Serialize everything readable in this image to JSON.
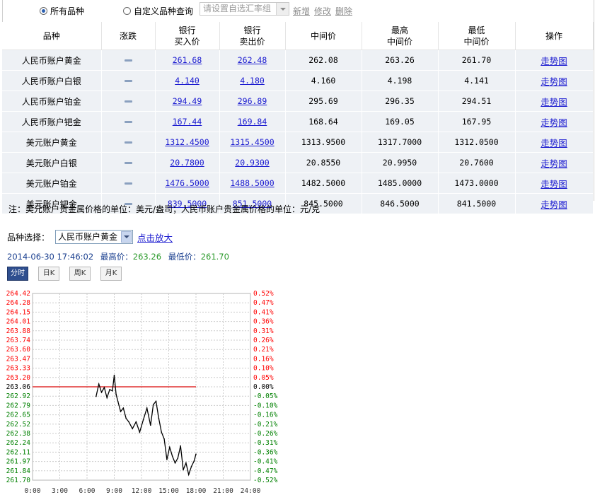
{
  "filter": {
    "radio_all": "所有品种",
    "radio_custom": "自定义品种查询",
    "combo_placeholder": "请设置自选汇率组",
    "add": "新增",
    "edit": "修改",
    "delete": "删除"
  },
  "table": {
    "headers": [
      "品种",
      "涨跌",
      "银行\n买入价",
      "银行\n卖出价",
      "中间价",
      "最高\n中间价",
      "最低\n中间价",
      "操作"
    ],
    "rows": [
      {
        "name": "人民币账户黄金",
        "buy": "261.68",
        "sell": "262.48",
        "mid": "262.08",
        "high": "263.26",
        "low": "261.70",
        "op": "走势图"
      },
      {
        "name": "人民币账户白银",
        "buy": "4.140",
        "sell": "4.180",
        "mid": "4.160",
        "high": "4.198",
        "low": "4.141",
        "op": "走势图"
      },
      {
        "name": "人民币账户铂金",
        "buy": "294.49",
        "sell": "296.89",
        "mid": "295.69",
        "high": "296.35",
        "low": "294.51",
        "op": "走势图"
      },
      {
        "name": "人民币账户钯金",
        "buy": "167.44",
        "sell": "169.84",
        "mid": "168.64",
        "high": "169.05",
        "low": "167.95",
        "op": "走势图"
      },
      {
        "name": "美元账户黄金",
        "buy": "1312.4500",
        "sell": "1315.4500",
        "mid": "1313.9500",
        "high": "1317.7000",
        "low": "1312.0500",
        "op": "走势图"
      },
      {
        "name": "美元账户白银",
        "buy": "20.7800",
        "sell": "20.9300",
        "mid": "20.8550",
        "high": "20.9950",
        "low": "20.7600",
        "op": "走势图"
      },
      {
        "name": "美元账户铂金",
        "buy": "1476.5000",
        "sell": "1488.5000",
        "mid": "1482.5000",
        "high": "1485.0000",
        "low": "1473.0000",
        "op": "走势图"
      },
      {
        "name": "美元账户钯金",
        "buy": "839.5000",
        "sell": "851.5000",
        "mid": "845.5000",
        "high": "846.5000",
        "low": "841.5000",
        "op": "走势图"
      }
    ]
  },
  "note": "注：美元账户贵金属价格的单位：美元/盎司；人民币账户贵金属价格的单位：元/克",
  "selector": {
    "label": "品种选择：",
    "value": "人民币账户黄金",
    "zoom": "点击放大"
  },
  "info": {
    "datetime": "2014-06-30 17:46:02",
    "high_label": "最高价：",
    "high_value": "263.26",
    "low_label": "最低价：",
    "low_value": "261.70"
  },
  "tabs": [
    "分时",
    "日K",
    "周K",
    "月K"
  ],
  "colors": {
    "up": "#ff0000",
    "down": "#008000",
    "ref_line": "#e03030",
    "line": "#000000",
    "grid": "#cccccc"
  },
  "chart_data": {
    "type": "line",
    "y_left_ticks": [
      "264.42",
      "264.28",
      "264.15",
      "264.01",
      "263.88",
      "263.74",
      "263.60",
      "263.47",
      "263.33",
      "263.20",
      "263.06",
      "262.92",
      "262.79",
      "262.65",
      "262.52",
      "262.38",
      "262.24",
      "262.11",
      "261.97",
      "261.84",
      "261.70"
    ],
    "y_right_ticks": [
      "0.52%",
      "0.47%",
      "0.41%",
      "0.36%",
      "0.31%",
      "0.26%",
      "0.21%",
      "0.16%",
      "0.10%",
      "0.05%",
      "0.00%",
      "-0.05%",
      "-0.10%",
      "-0.16%",
      "-0.21%",
      "-0.26%",
      "-0.31%",
      "-0.36%",
      "-0.41%",
      "-0.47%",
      "-0.52%"
    ],
    "x_ticks": [
      "0:00",
      "3:00",
      "6:00",
      "9:00",
      "12:00",
      "15:00",
      "18:00",
      "21:00",
      "24:00"
    ],
    "reference_value": 263.06,
    "reference_end_hour": 18.0,
    "ylim": [
      261.7,
      264.42
    ],
    "xlim": [
      0,
      24
    ],
    "series": [
      {
        "x": [
          7.0,
          7.3,
          7.6,
          7.9,
          8.2,
          8.5,
          8.8,
          9.0,
          9.2,
          9.4,
          9.7,
          10.0,
          10.3,
          10.6,
          11.0,
          11.4,
          11.8,
          12.2,
          12.6,
          13.0,
          13.3,
          13.6,
          13.9,
          14.2,
          14.5,
          14.8,
          15.1,
          15.4,
          15.7,
          16.0,
          16.3,
          16.6,
          16.9,
          17.2,
          17.5,
          17.8,
          18.0
        ],
        "y": [
          262.92,
          263.1,
          262.98,
          263.05,
          262.9,
          263.02,
          263.0,
          263.23,
          262.95,
          262.85,
          262.7,
          262.75,
          262.6,
          262.55,
          262.45,
          262.55,
          262.4,
          262.58,
          262.75,
          262.5,
          262.8,
          262.85,
          262.6,
          262.4,
          262.3,
          262.0,
          262.18,
          262.05,
          261.95,
          262.02,
          262.2,
          261.85,
          261.95,
          261.78,
          261.9,
          261.98,
          262.08
        ]
      }
    ]
  }
}
